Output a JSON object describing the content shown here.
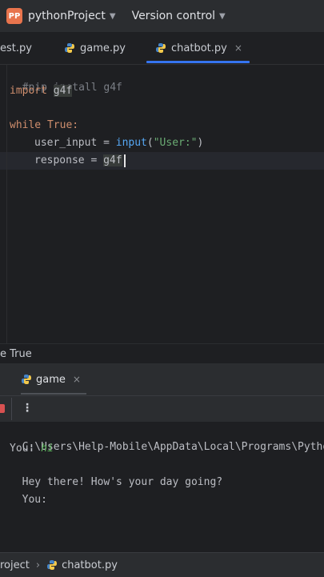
{
  "titlebar": {
    "logo": "PP",
    "project": "pythonProject",
    "vcs": "Version control"
  },
  "tabs": [
    {
      "label": "est.py",
      "icon": "python-icon"
    },
    {
      "label": "game.py",
      "icon": "python-icon"
    },
    {
      "label": "chatbot.py",
      "icon": "python-icon",
      "active": true,
      "close": "×"
    }
  ],
  "code": {
    "l1": "#pip install g4f",
    "l2_kw": "import",
    "l2_mod": "g4f",
    "l3_kw": "while",
    "l3_rest": " True:",
    "l4_var": "user_input = ",
    "l4_fn": "input",
    "l4_open": "(",
    "l4_str": "\"User:\"",
    "l4_close": ")",
    "l5_var": "response = ",
    "l5_mod": "g4f"
  },
  "breadcrumb": "e True",
  "run": {
    "tab_label": "game",
    "tab_close": "×",
    "menu_glyph": "⋮"
  },
  "console": {
    "path": "C:\\Users\\Help-Mobile\\AppData\\Local\\Programs\\Python",
    "prompt1": "You: ",
    "input1": "hi",
    "reply": "Hey there! How's your day going?",
    "prompt2": "You:"
  },
  "statusbar": {
    "project": "roject",
    "sep": "›",
    "file": "chatbot.py"
  },
  "colors": {
    "accent": "#3574f0",
    "keyword": "#cf8e6d",
    "function": "#56a8f5",
    "string": "#6aab73",
    "stop": "#d85151"
  }
}
